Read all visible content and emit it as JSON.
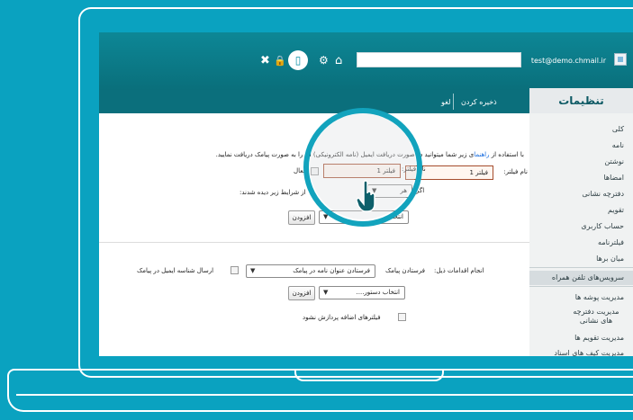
{
  "header": {
    "user_email": "test@demo.chmail.ir",
    "icons": [
      "home-icon",
      "gear-icon",
      "mobile-icon",
      "lock-icon",
      "close-icon"
    ]
  },
  "strip": {
    "title": "تنظیمات",
    "save_label": "ذخیره کردن",
    "cancel_label": "لغو"
  },
  "sidebar": {
    "items": [
      "کلی",
      "نامه",
      "نوشتن",
      "امضاها",
      "دفترچه نشانی",
      "تقویم",
      "حساب کاربری",
      "فیلترنامه",
      "میان برها",
      "سرویس‌های تلفن همراه",
      "مدیریت پوشه ها",
      "مدیریت دفترچه های نشانی",
      "مدیریت تقویم ها",
      "مدیریت کیف های اسناد"
    ]
  },
  "filter": {
    "description_before": "با استفاده از",
    "description_link": "راهنما",
    "description_after": "ی زیر شما میتوانید در صورت دریافت ایمیل (نامه الکترونیکی) آن را به صورت پیامک دریافت نمایید.",
    "name_label": "نام فیلتر:",
    "name_value": "فیلتر 1",
    "active_label": "فعال",
    "if_label": "اگر",
    "condition_select": "هر",
    "condition_text": "از شرایط زیر دیده شدند:",
    "add_select": "انتخاب",
    "add_button": "افزودن"
  },
  "actions": {
    "label": "انجام اقدامات ذیل:",
    "sender_label": "فرستادن پیامک",
    "sender_select": "فرستادن عنوان نامه در پیامک",
    "email_id_label": "ارسال شناسه ایمیل در پیامک",
    "command_select": "انتخاب دستور....",
    "add_button": "افزودن",
    "no_more_filters": "فیلترهای اضافه پردازش نشود"
  },
  "colors": {
    "background": "#0aa2c0",
    "header": "#0b6f7c",
    "accent_ring": "#12a3bd"
  }
}
